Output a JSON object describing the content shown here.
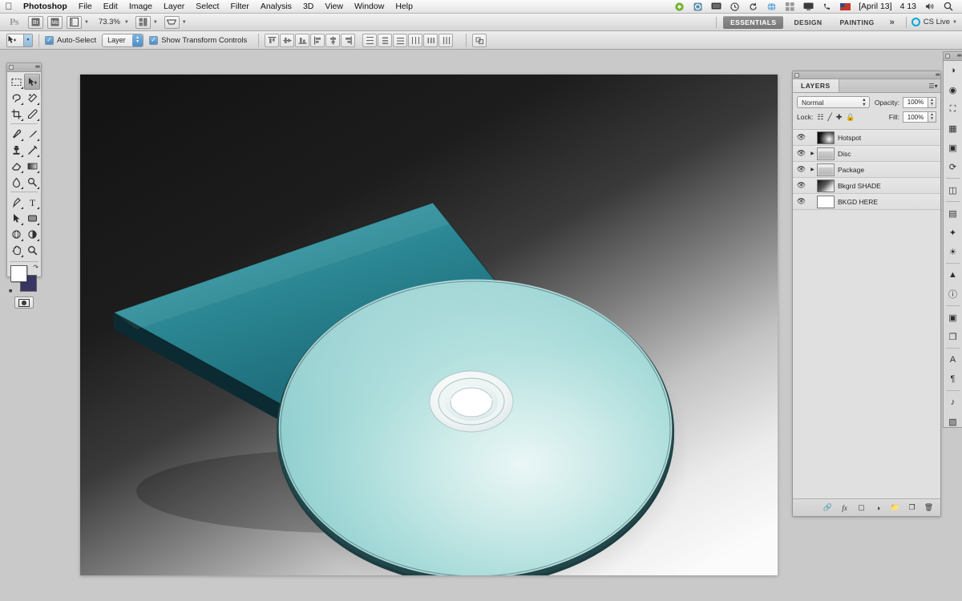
{
  "menubar": {
    "apple_icon": "apple-logo",
    "items": [
      {
        "label": "Photoshop",
        "bold": true
      },
      {
        "label": "File"
      },
      {
        "label": "Edit"
      },
      {
        "label": "Image"
      },
      {
        "label": "Layer"
      },
      {
        "label": "Select"
      },
      {
        "label": "Filter"
      },
      {
        "label": "Analysis"
      },
      {
        "label": "3D"
      },
      {
        "label": "View"
      },
      {
        "label": "Window"
      },
      {
        "label": "Help"
      }
    ],
    "status_icons": [
      "dropbox-icon",
      "sync-icon",
      "display-icon",
      "timemachine-icon",
      "refresh-icon",
      "globe-icon",
      "grid-icon",
      "screen-icon",
      "phone-icon",
      "flag-icon"
    ],
    "date": "[April 13]",
    "clock": "4 13",
    "volume_icon": "volume-icon",
    "search_icon": "spotlight-search-icon"
  },
  "appbar": {
    "ps_mark": "Ps",
    "bridge_label": "launch-bridge-icon",
    "mini_bridge_label": "launch-mini-bridge-icon",
    "view_extras_icon": "view-extras-icon",
    "zoom_level": "73.3%",
    "arrange_icon": "arrange-documents-icon",
    "screen_mode_icon": "screen-mode-icon",
    "workspaces": [
      {
        "label": "ESSENTIALS",
        "active": true
      },
      {
        "label": "DESIGN",
        "active": false
      },
      {
        "label": "PAINTING",
        "active": false
      }
    ],
    "more_label": "»",
    "cslive_label": "CS Live"
  },
  "optionsbar": {
    "tool_preset_icon": "move-tool-icon",
    "auto_select": {
      "label": "Auto-Select",
      "checked": true
    },
    "auto_select_scope": "Layer",
    "show_transform": {
      "label": "Show Transform Controls",
      "checked": true
    },
    "align_group_1": [
      "align-top-edges-icon",
      "align-vertical-centers-icon",
      "align-bottom-edges-icon",
      "align-left-edges-icon",
      "align-horizontal-centers-icon",
      "align-right-edges-icon"
    ],
    "align_group_2": [
      "distribute-top-edges-icon",
      "distribute-vertical-centers-icon",
      "distribute-bottom-edges-icon",
      "distribute-left-edges-icon",
      "distribute-horizontal-centers-icon",
      "distribute-right-edges-icon"
    ],
    "auto_align_icon": "auto-align-layers-icon"
  },
  "toolbox": {
    "tools": [
      {
        "name": "rectangular-marquee-tool",
        "glyph": "⬚",
        "active": false,
        "more": true
      },
      {
        "name": "move-tool",
        "glyph": "↖",
        "active": true,
        "more": false
      },
      {
        "name": "lasso-tool",
        "glyph": "⬭",
        "active": false,
        "more": true
      },
      {
        "name": "quick-selection-tool",
        "glyph": "✦",
        "active": false,
        "more": true
      },
      {
        "name": "crop-tool",
        "glyph": "⌗",
        "active": false,
        "more": true
      },
      {
        "name": "eyedropper-tool",
        "glyph": "✐",
        "active": false,
        "more": true
      },
      {
        "name": "spot-healing-brush-tool",
        "glyph": "✎",
        "active": false,
        "more": true
      },
      {
        "name": "brush-tool",
        "glyph": "✒",
        "active": false,
        "more": true
      },
      {
        "name": "clone-stamp-tool",
        "glyph": "⚓",
        "active": false,
        "more": true
      },
      {
        "name": "history-brush-tool",
        "glyph": "✑",
        "active": false,
        "more": true
      },
      {
        "name": "eraser-tool",
        "glyph": "▱",
        "active": false,
        "more": true
      },
      {
        "name": "gradient-tool",
        "glyph": "◨",
        "active": false,
        "more": true
      },
      {
        "name": "blur-tool",
        "glyph": "◌",
        "active": false,
        "more": true
      },
      {
        "name": "dodge-tool",
        "glyph": "◔",
        "active": false,
        "more": true
      },
      {
        "name": "pen-tool",
        "glyph": "✒",
        "active": false,
        "more": true
      },
      {
        "name": "horizontal-type-tool",
        "glyph": "T",
        "active": false,
        "more": true
      },
      {
        "name": "path-selection-tool",
        "glyph": "⮝",
        "active": false,
        "more": true
      },
      {
        "name": "rectangle-tool",
        "glyph": "▭",
        "active": false,
        "more": true
      },
      {
        "name": "3d-object-rotate-tool",
        "glyph": "◑",
        "active": false,
        "more": true
      },
      {
        "name": "3d-camera-rotate-tool",
        "glyph": "◕",
        "active": false,
        "more": true
      },
      {
        "name": "hand-tool",
        "glyph": "✋",
        "active": false,
        "more": true
      },
      {
        "name": "zoom-tool",
        "glyph": "⌕",
        "active": false,
        "more": false
      }
    ],
    "foreground_color": "#ffffff",
    "background_color": "#3a3663",
    "swap_icon": "swap-colors-icon",
    "default_icon": "default-colors-icon",
    "quick_mask_icon": "quick-mask-mode-icon"
  },
  "layers_panel": {
    "tab_label": "LAYERS",
    "panel_menu_icon": "panel-menu-icon",
    "blend_mode": "Normal",
    "opacity_label": "Opacity:",
    "opacity_value": "100%",
    "lock_label": "Lock:",
    "lock_icons": [
      "lock-transparent-pixels-icon",
      "lock-image-pixels-icon",
      "lock-position-icon",
      "lock-all-icon"
    ],
    "fill_label": "Fill:",
    "fill_value": "100%",
    "layers": [
      {
        "name": "Hotspot",
        "visible": true,
        "type": "raster",
        "expandable": false,
        "thumb": "hotspot"
      },
      {
        "name": "Disc",
        "visible": true,
        "type": "group",
        "expandable": true,
        "thumb": "folder"
      },
      {
        "name": "Package",
        "visible": true,
        "type": "group",
        "expandable": true,
        "thumb": "folder"
      },
      {
        "name": "Bkgrd SHADE",
        "visible": true,
        "type": "raster",
        "expandable": false,
        "thumb": "shade"
      },
      {
        "name": "BKGD HERE",
        "visible": true,
        "type": "raster",
        "expandable": false,
        "thumb": "white"
      }
    ],
    "footer_buttons": [
      "link-layers-icon",
      "add-layer-style-icon",
      "add-layer-mask-icon",
      "new-adjustment-layer-icon",
      "new-group-icon",
      "new-layer-icon",
      "delete-layer-icon"
    ]
  },
  "icon_dock": {
    "icons": [
      "adjustments-panel-icon",
      "styles-panel-icon",
      "masks-panel-icon",
      "color-panel-icon",
      "swatches-panel-icon",
      "history-panel-icon",
      "navigator-panel-icon",
      "info-panel-icon",
      "layer-comps-panel-icon",
      "clone-source-panel-icon",
      "character-panel-icon",
      "paragraph-panel-icon",
      "paths-panel-icon",
      "channels-panel-icon"
    ]
  },
  "canvas": {
    "artwork_name": "cd-case-and-disc-mockup",
    "accent_teal": "#2d8a98",
    "disc_teal": "#a8dbdb",
    "backdrop_dark": "#1b1b1b",
    "backdrop_light": "#f2f2f2"
  }
}
